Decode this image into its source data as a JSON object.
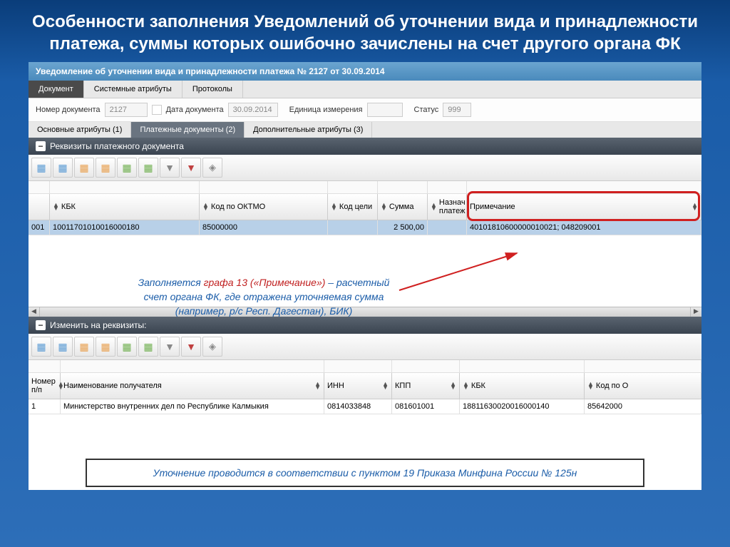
{
  "slide_title": "Особенности заполнения Уведомлений об уточнении вида и принадлежности платежа, суммы которых ошибочно зачислены на счет другого органа ФК",
  "window_header": "Уведомление об уточнении вида и принадлежности платежа № 2127 от 30.09.2014",
  "tabs": {
    "document": "Документ",
    "system_attrs": "Системные атрибуты",
    "protocols": "Протоколы"
  },
  "form": {
    "doc_num_label": "Номер документа",
    "doc_num": "2127",
    "doc_date_label": "Дата документа",
    "doc_date": "30.09.2014",
    "unit_label": "Единица измерения",
    "unit": "",
    "status_label": "Статус",
    "status": "999"
  },
  "subtabs": {
    "main": "Основные атрибуты (1)",
    "payment": "Платежные документы (2)",
    "extra": "Дополнительные атрибуты (3)"
  },
  "section1": {
    "title": "Реквизиты платежного документа",
    "cols": {
      "kbk": "КБК",
      "oktmo": "Код по ОКТМО",
      "target": "Код цели",
      "sum": "Сумма",
      "purpose": "Назнач платеж",
      "note": "Примечание"
    },
    "row": {
      "num": "001",
      "kbk": "10011701010016000180",
      "oktmo": "85000000",
      "target": "",
      "sum": "2 500,00",
      "purpose": "",
      "note": "40101810600000010021; 048209001"
    }
  },
  "section2": {
    "title": "Изменить на реквизиты:",
    "cols": {
      "np": "Номер п/п",
      "recipient": "Наименование получателя",
      "inn": "ИНН",
      "kpp": "КПП",
      "kbk": "КБК",
      "oktmo": "Код по О"
    },
    "row": {
      "np": "1",
      "recipient": "Министерство внутренних дел по Республике Калмыкия",
      "inn": "0814033848",
      "kpp": "081601001",
      "kbk": "18811630020016000140",
      "oktmo": "85642000"
    }
  },
  "annotation": {
    "line1_a": "Заполняется ",
    "line1_b": "графа 13 («Примечание»)",
    "line1_c": " – расчетный",
    "line2": "счет органа ФК, где отражена уточняемая сумма",
    "line3": "(например, р/с Респ. Дагестан), БИК)"
  },
  "bottom_note": "Уточнение проводится в соответствии с пунктом 19 Приказа Минфина России № 125н"
}
